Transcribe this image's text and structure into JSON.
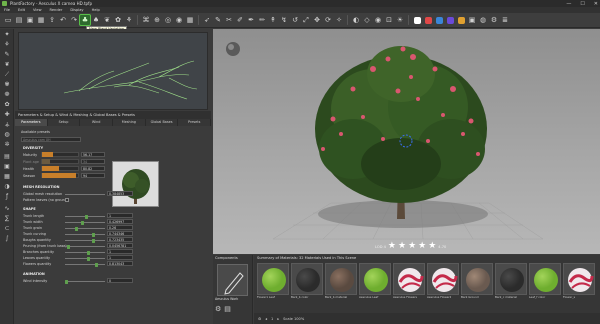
{
  "window": {
    "title": "PlantFactory - Aesculus X carnea HD.tpfp",
    "min": "—",
    "max": "☐",
    "close": "✕"
  },
  "menu": [
    "File",
    "Edit",
    "View",
    "Render",
    "Display",
    "Help"
  ],
  "tooltip": "New Plant Variation",
  "toolbar_swatches": [
    "#ffffff",
    "#e04848",
    "#3a86d8",
    "#6a4ad8",
    "#e0a030",
    "#d8d8d8"
  ],
  "panel": {
    "header": "Parameters & Setup & Wind & Meshing & Global Bases & Presets",
    "tabs": [
      "Parameters",
      "Setup",
      "Wind",
      "Meshing",
      "Global Bases",
      "Presets"
    ],
    "presets_label": "Available presets",
    "preset_value": "Aesculus cam XH",
    "diversity_title": "DIVERSITY",
    "diversity": [
      {
        "label": "Maturity",
        "value": "56.17",
        "unit": "%",
        "fill": 0.3
      },
      {
        "label": "Plant age",
        "value": "34",
        "unit": "",
        "fill": 0.2
      },
      {
        "label": "Health",
        "value": "80.82",
        "unit": "%",
        "fill": 0.45
      },
      {
        "label": "Season",
        "value": "94",
        "unit": "%",
        "fill": 0.9
      }
    ],
    "mesh_title": "MESH RESOLUTION",
    "mesh": [
      {
        "label": "Global mesh resolution",
        "value": "0.384853"
      },
      {
        "label": "Pattern leaves (no ground)",
        "value": ""
      }
    ],
    "shape_title": "SHAPE",
    "shape": [
      {
        "label": "Trunk length",
        "value": "1",
        "pos": 0.55
      },
      {
        "label": "Trunk width",
        "value": "0.426997",
        "pos": 0.42
      },
      {
        "label": "Trunk grain",
        "value": "0.26",
        "pos": 0.26
      },
      {
        "label": "Trunk curving",
        "value": "0.744346",
        "pos": 0.74
      },
      {
        "label": "Boughs quantity",
        "value": "0.723435",
        "pos": 0.72
      },
      {
        "label": "Pruning (from trunk base)",
        "value": "0.0456781",
        "pos": 0.05
      },
      {
        "label": "Branches quantity",
        "value": "1",
        "pos": 0.6
      },
      {
        "label": "Leaves quantity",
        "value": "1",
        "pos": 0.6
      },
      {
        "label": "Flowers quantity",
        "value": "0.813043",
        "pos": 0.81
      }
    ],
    "animation_title": "ANIMATION",
    "animation": [
      {
        "label": "Wind intensity",
        "value": "0",
        "pos": 0.0
      }
    ]
  },
  "viewport": {
    "lod_label": "LOD 4",
    "lod_value": "4.70",
    "stars": 5
  },
  "components": {
    "title": "Components",
    "item": "Aesculus Work"
  },
  "materials": {
    "title": "Summary of Materials: 32 Materials Used in This Scene",
    "items": [
      {
        "name": "Flower1 Leaf",
        "kind": "leaf"
      },
      {
        "name": "Bark_b color",
        "kind": "dark"
      },
      {
        "name": "Bark_b material",
        "kind": "bark"
      },
      {
        "name": "Aesculus Leaf",
        "kind": "leaf"
      },
      {
        "name": "Aesculus Flowers",
        "kind": "flower"
      },
      {
        "name": "Aesculus Flower2",
        "kind": "flower"
      },
      {
        "name": "Bark Ground",
        "kind": "bark2"
      },
      {
        "name": "Bark_c material",
        "kind": "dark"
      },
      {
        "name": "Leaf_f color",
        "kind": "leaf"
      },
      {
        "name": "Flower_s",
        "kind": "flower"
      }
    ]
  },
  "status": {
    "zoom": "Scale 100%",
    "frame": "1"
  }
}
